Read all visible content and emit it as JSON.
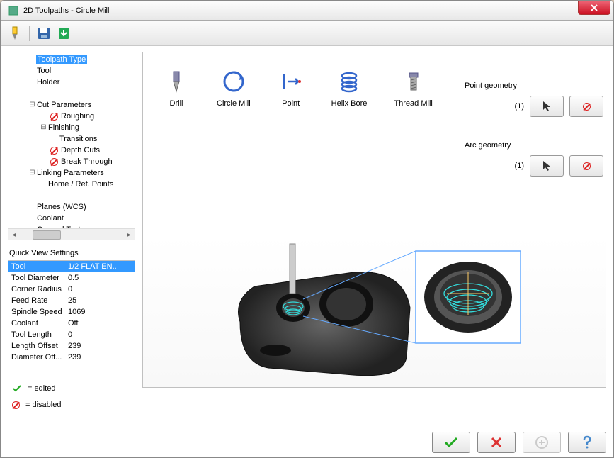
{
  "window": {
    "title": "2D Toolpaths - Circle Mill"
  },
  "tree": {
    "items": [
      {
        "label": "Toolpath Type",
        "depth": 1,
        "selected": true,
        "icon": "",
        "expander": ""
      },
      {
        "label": "Tool",
        "depth": 1,
        "icon": "",
        "expander": ""
      },
      {
        "label": "Holder",
        "depth": 1,
        "icon": "",
        "expander": ""
      },
      {
        "label": "",
        "depth": 1,
        "icon": "",
        "expander": ""
      },
      {
        "label": "Cut Parameters",
        "depth": 1,
        "icon": "",
        "expander": "minus"
      },
      {
        "label": "Roughing",
        "depth": 2,
        "icon": "no",
        "expander": ""
      },
      {
        "label": "Finishing",
        "depth": 2,
        "icon": "",
        "expander": "minus"
      },
      {
        "label": "Transitions",
        "depth": 3,
        "icon": "",
        "expander": ""
      },
      {
        "label": "Depth Cuts",
        "depth": 2,
        "icon": "no",
        "expander": ""
      },
      {
        "label": "Break Through",
        "depth": 2,
        "icon": "no",
        "expander": ""
      },
      {
        "label": "Linking Parameters",
        "depth": 1,
        "icon": "",
        "expander": "minus"
      },
      {
        "label": "Home / Ref. Points",
        "depth": 2,
        "icon": "",
        "expander": ""
      },
      {
        "label": "",
        "depth": 1,
        "icon": "",
        "expander": ""
      },
      {
        "label": "Planes (WCS)",
        "depth": 1,
        "icon": "",
        "expander": ""
      },
      {
        "label": "Coolant",
        "depth": 1,
        "icon": "",
        "expander": ""
      },
      {
        "label": "Canned Text",
        "depth": 1,
        "icon": "",
        "expander": ""
      }
    ]
  },
  "quick_view": {
    "title": "Quick View Settings",
    "rows": [
      {
        "k": "Tool",
        "v": "1/2 FLAT EN..",
        "selected": true
      },
      {
        "k": "Tool Diameter",
        "v": "0.5"
      },
      {
        "k": "Corner Radius",
        "v": "0"
      },
      {
        "k": "Feed Rate",
        "v": "25"
      },
      {
        "k": "Spindle Speed",
        "v": "1069"
      },
      {
        "k": "Coolant",
        "v": "Off"
      },
      {
        "k": "Tool Length",
        "v": "0"
      },
      {
        "k": "Length Offset",
        "v": "239"
      },
      {
        "k": "Diameter Off...",
        "v": "239"
      }
    ]
  },
  "legend": {
    "edited": "= edited",
    "disabled": "= disabled"
  },
  "toolpaths": [
    {
      "label": "Drill",
      "icon": "drill"
    },
    {
      "label": "Circle Mill",
      "icon": "circle"
    },
    {
      "label": "Point",
      "icon": "point"
    },
    {
      "label": "Helix Bore",
      "icon": "helix"
    },
    {
      "label": "Thread Mill",
      "icon": "thread"
    }
  ],
  "geometry": {
    "point": {
      "label": "Point geometry",
      "count": "(1)"
    },
    "arc": {
      "label": "Arc geometry",
      "count": "(1)"
    }
  }
}
